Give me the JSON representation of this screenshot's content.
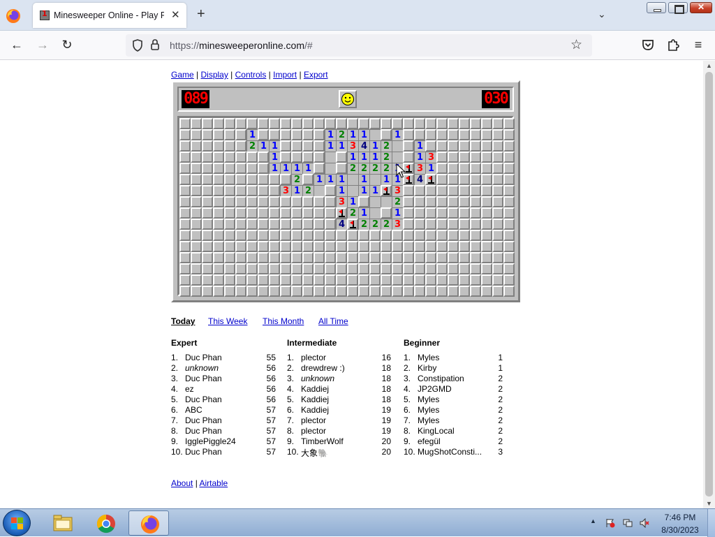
{
  "browser": {
    "tab_title": "Minesweeper Online - Play Free",
    "url_prefix": "https://",
    "url_host": "minesweeperonline.com",
    "url_path": "/#"
  },
  "game_menu": [
    "Game",
    "Display",
    "Controls",
    "Import",
    "Export"
  ],
  "game": {
    "mine_counter": "089",
    "timer": "030",
    "columns": 30,
    "rows": 16,
    "board": [
      "..............................",
      "......1......12110.1..........",
      "......211....1134120.1........",
      "........1....0.11120.13.......",
      "........1111.0.22221F31.......",
      "..........2.11101011F4F.......",
      ".........3120.1011F3..........",
      "..............31.002..........",
      "..............F210.1..........",
      "..............4F2223..........",
      "..............................",
      "..............................",
      "..............................",
      "..............................",
      "..............................",
      ".............................."
    ],
    "board_legend": {
      ".": "covered",
      "0": "revealed-empty",
      "1": "1",
      "2": "2",
      "3": "3",
      "4": "4",
      "F": "flag"
    },
    "colors": {
      "1": "#0000ff",
      "2": "#008000",
      "3": "#ff0000",
      "4": "#000080",
      "flag": "#ff0000",
      "surface": "#c0c0c0"
    }
  },
  "highscores": {
    "periods": [
      "Today",
      "This Week",
      "This Month",
      "All Time"
    ],
    "selected_period": "Today",
    "categories": [
      {
        "title": "Expert",
        "entries": [
          {
            "rank": "1.",
            "name": "Duc Phan",
            "time": "55"
          },
          {
            "rank": "2.",
            "name": "unknown",
            "time": "56",
            "italic": true
          },
          {
            "rank": "3.",
            "name": "Duc Phan",
            "time": "56"
          },
          {
            "rank": "4.",
            "name": "ez",
            "time": "56"
          },
          {
            "rank": "5.",
            "name": "Duc Phan",
            "time": "56"
          },
          {
            "rank": "6.",
            "name": "ABC",
            "time": "57"
          },
          {
            "rank": "7.",
            "name": "Duc Phan",
            "time": "57"
          },
          {
            "rank": "8.",
            "name": "Duc Phan",
            "time": "57"
          },
          {
            "rank": "9.",
            "name": "IgglePiggle24",
            "time": "57"
          },
          {
            "rank": "10.",
            "name": "Duc Phan",
            "time": "57"
          }
        ]
      },
      {
        "title": "Intermediate",
        "entries": [
          {
            "rank": "1.",
            "name": "plector",
            "time": "16"
          },
          {
            "rank": "2.",
            "name": "drewdrew :)",
            "time": "18"
          },
          {
            "rank": "3.",
            "name": "unknown",
            "time": "18",
            "italic": true
          },
          {
            "rank": "4.",
            "name": "Kaddiej",
            "time": "18"
          },
          {
            "rank": "5.",
            "name": "Kaddiej",
            "time": "18"
          },
          {
            "rank": "6.",
            "name": "Kaddiej",
            "time": "19"
          },
          {
            "rank": "7.",
            "name": "plector",
            "time": "19"
          },
          {
            "rank": "8.",
            "name": "plector",
            "time": "19"
          },
          {
            "rank": "9.",
            "name": "TimberWolf",
            "time": "20"
          },
          {
            "rank": "10.",
            "name": "大象🐘",
            "time": "20"
          }
        ]
      },
      {
        "title": "Beginner",
        "entries": [
          {
            "rank": "1.",
            "name": "Myles",
            "time": "1"
          },
          {
            "rank": "2.",
            "name": "Kirby",
            "time": "1"
          },
          {
            "rank": "3.",
            "name": "Constipation",
            "time": "2"
          },
          {
            "rank": "4.",
            "name": "JP2GMD",
            "time": "2"
          },
          {
            "rank": "5.",
            "name": "Myles",
            "time": "2"
          },
          {
            "rank": "6.",
            "name": "Myles",
            "time": "2"
          },
          {
            "rank": "7.",
            "name": "Myles",
            "time": "2"
          },
          {
            "rank": "8.",
            "name": "KingLocal",
            "time": "2"
          },
          {
            "rank": "9.",
            "name": "efegül",
            "time": "2"
          },
          {
            "rank": "10.",
            "name": "MugShotConsti...",
            "time": "3"
          }
        ]
      }
    ]
  },
  "footer": {
    "about": "About",
    "separator": "|",
    "airtable": "Airtable"
  },
  "taskbar": {
    "apps": [
      "windows-explorer-icon",
      "chrome-icon",
      "firefox-icon"
    ],
    "time": "7:46 PM",
    "date": "8/30/2023"
  }
}
